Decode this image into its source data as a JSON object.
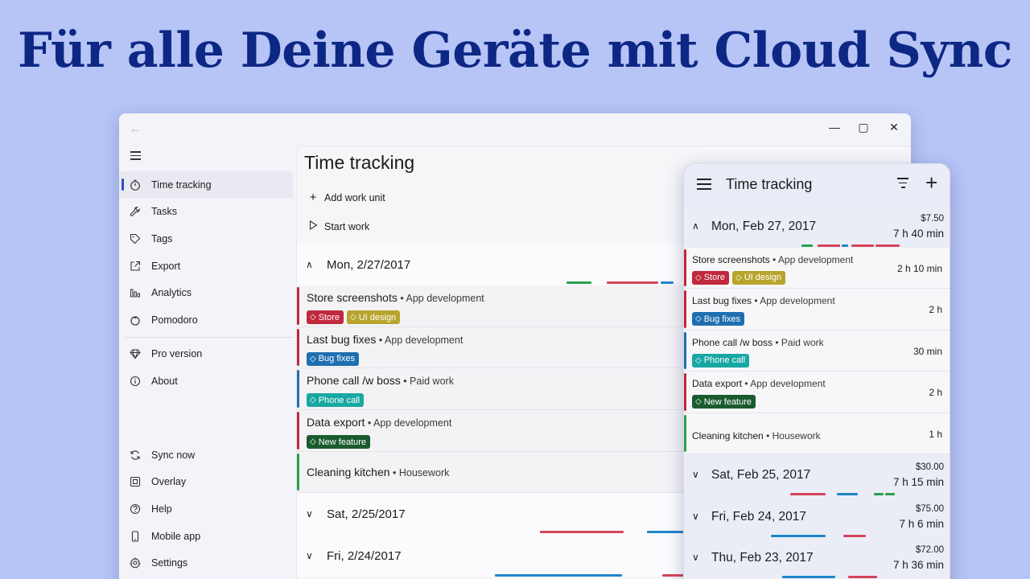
{
  "headline": "Für alle Deine Geräte mit Cloud Sync",
  "colors": {
    "store": "#c0283c",
    "ui_design": "#b8a42c",
    "bug_fixes": "#1f6fb0",
    "phone_call": "#19a7a3",
    "new_feature": "#1a5b30",
    "housework": "#2aa04e",
    "accent": "#2b4fc2"
  },
  "window": {
    "controls": {
      "minimize": "—",
      "maximize": "▢",
      "close": "✕"
    },
    "nav": {
      "main": [
        {
          "label": "Time tracking",
          "icon": "stopwatch-icon"
        },
        {
          "label": "Tasks",
          "icon": "wrench-icon"
        },
        {
          "label": "Tags",
          "icon": "tag-icon"
        },
        {
          "label": "Export",
          "icon": "export-icon"
        },
        {
          "label": "Analytics",
          "icon": "chart-icon"
        },
        {
          "label": "Pomodoro",
          "icon": "tomato-icon"
        },
        {
          "label": "Pro version",
          "icon": "diamond-icon"
        },
        {
          "label": "About",
          "icon": "info-icon"
        }
      ],
      "bottom": [
        {
          "label": "Sync now",
          "icon": "sync-icon"
        },
        {
          "label": "Overlay",
          "icon": "overlay-icon"
        },
        {
          "label": "Help",
          "icon": "help-icon"
        },
        {
          "label": "Mobile app",
          "icon": "phone-icon"
        },
        {
          "label": "Settings",
          "icon": "gear-icon"
        }
      ]
    },
    "content": {
      "title": "Time tracking",
      "add_work_unit": "Add work unit",
      "start_work": "Start work",
      "days": [
        {
          "date": "Mon, 2/27/2017",
          "entries": [
            {
              "title": "Store screenshots",
              "project": " • App development",
              "color": "#c0283c",
              "tags": [
                {
                  "label": "Store",
                  "color": "#c0283c"
                },
                {
                  "label": "UI design",
                  "color": "#b8a42c"
                }
              ]
            },
            {
              "title": "Last bug fixes",
              "project": " • App development",
              "color": "#c0283c",
              "tags": [
                {
                  "label": "Bug fixes",
                  "color": "#1f6fb0"
                }
              ]
            },
            {
              "title": "Phone call /w boss",
              "project": " • Paid work",
              "color": "#1f6fb0",
              "tags": [
                {
                  "label": "Phone call",
                  "color": "#19a7a3"
                }
              ]
            },
            {
              "title": "Data export",
              "project": " • App development",
              "color": "#c0283c",
              "tags": [
                {
                  "label": "New feature",
                  "color": "#1a5b30"
                }
              ]
            },
            {
              "title": "Cleaning kitchen",
              "project": " • Housework",
              "color": "#2aa04e",
              "tags": []
            }
          ]
        },
        {
          "date": "Sat, 2/25/2017"
        },
        {
          "date": "Fri, 2/24/2017"
        }
      ]
    }
  },
  "mobile": {
    "title": "Time tracking",
    "days": [
      {
        "date": "Mon, Feb 27, 2017",
        "price": "$7.50",
        "total": "7 h 40 min",
        "entries": [
          {
            "title": "Store screenshots",
            "project": " • App development",
            "duration": "2 h 10 min",
            "color": "#c0283c",
            "tags": [
              {
                "label": "Store",
                "color": "#c0283c"
              },
              {
                "label": "UI design",
                "color": "#b8a42c"
              }
            ]
          },
          {
            "title": "Last bug fixes",
            "project": " • App development",
            "duration": "2 h",
            "color": "#c0283c",
            "tags": [
              {
                "label": "Bug fixes",
                "color": "#1f6fb0"
              }
            ]
          },
          {
            "title": "Phone call /w boss",
            "project": " • Paid work",
            "duration": "30 min",
            "color": "#1f6fb0",
            "tags": [
              {
                "label": "Phone call",
                "color": "#19a7a3"
              }
            ]
          },
          {
            "title": "Data export",
            "project": " • App development",
            "duration": "2 h",
            "color": "#c0283c",
            "tags": [
              {
                "label": "New feature",
                "color": "#1a5b30"
              }
            ]
          },
          {
            "title": "Cleaning kitchen",
            "project": " • Housework",
            "duration": "1 h",
            "color": "#2aa04e",
            "tags": []
          }
        ]
      },
      {
        "date": "Sat, Feb 25, 2017",
        "price": "$30.00",
        "total": "7 h 15 min"
      },
      {
        "date": "Fri, Feb 24, 2017",
        "price": "$75.00",
        "total": "7 h 6 min"
      },
      {
        "date": "Thu, Feb 23, 2017",
        "price": "$72.00",
        "total": "7 h 36 min"
      }
    ]
  }
}
